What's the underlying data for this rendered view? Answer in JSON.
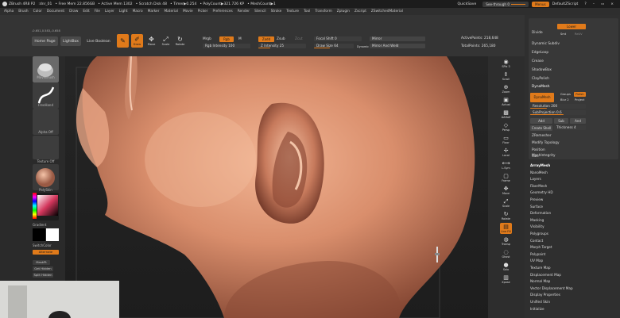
{
  "titlebar": {
    "app": "ZBrush 4R8 P2",
    "doc": ":dnr_01",
    "free_mem": "• Free Mem 22.856GB",
    "active_mem": "• Active Mem 1302",
    "scratch": "• Scratch Disk 48",
    "timer": "• Timer▶0.254",
    "polycount": "• PolyCount▶321.726 KP",
    "meshcount": "• MeshCount▶1",
    "quicksave": "QuickSave",
    "see_through": "See-through",
    "see_through_value": "0",
    "menus_label": "Menus",
    "default_script": "DefaultZScript"
  },
  "menubar": [
    "Alpha",
    "Brush",
    "Color",
    "Document",
    "Draw",
    "Edit",
    "File",
    "Layer",
    "Light",
    "Macro",
    "Marker",
    "Material",
    "Movie",
    "Picker",
    "Preferences",
    "Render",
    "Stencil",
    "Stroke",
    "Texture",
    "Tool",
    "Transform",
    "Zplugin",
    "Zscript",
    "ZSwitchedMaterial"
  ],
  "coords": "-0.651,0.583,-0.658",
  "toolbar": {
    "home_page": "Home Page",
    "lightbox": "LightBox",
    "live_boolean": "Live Boolean",
    "edit": "Edit",
    "draw": "Draw",
    "move": "Move",
    "scale": "Scale",
    "rotate": "Rotate",
    "mrgb": "Mrgb",
    "rgb": "Rgb",
    "m": "M",
    "rgb_intensity": "Rgb Intensity 100",
    "zadd": "Zadd",
    "zsub": "Zsub",
    "zcut": "Zcut",
    "z_intensity": "Z Intensity 25",
    "focal_shift": "Focal Shift 0",
    "draw_size": "Draw Size 64",
    "dynamic": "Dynamic",
    "mirror": "Mirror",
    "mirror_and_weld": "Mirror And Weld",
    "active_points": "ActivePoints: 218,648",
    "total_points": "TotalPoints: 265,180"
  },
  "leftpanel": {
    "brush_label": "MoveBrush",
    "stroke_label": "FreeHand",
    "alpha_label": "Alpha Off",
    "texture_label": "Texture Off",
    "material_label": "PolySkin",
    "gradient": "Gradient",
    "switch_color": "SwitchColor",
    "alternate": "Alternate",
    "mask_b": "MaskPt",
    "get_hidden": "Get Hidden",
    "split_hidden": "Split Hidden"
  },
  "rshelf": [
    "SPix 3",
    "Scroll",
    "Zoom",
    "Actual",
    "AAHalf",
    "Persp",
    "Floor",
    "Local",
    "L.Sym",
    "Frame",
    "Move",
    "Scale",
    "Rotate",
    "Line Fill",
    "Transp",
    "Ghost",
    "Solo",
    "Xpose"
  ],
  "geometry": {
    "divide": "Divide",
    "lower": "Lower",
    "smt": "Smt",
    "suv": "Suv",
    "reuv": "ReUV",
    "dynamic_subdiv": "Dynamic Subdiv",
    "edgeloop": "EdgeLoop",
    "crease": "Crease",
    "shadowbox": "ShadowBox",
    "claypolish": "ClayPolish",
    "dynamesh_header": "DynaMesh",
    "dynamesh_btn": "DynaMesh",
    "groups": "Groups",
    "polish": "Polish",
    "blur": "Blur 2",
    "project": "Project",
    "resolution": "Resolution 200",
    "subprojection": "SubProjection 0.6",
    "add": "Add",
    "sub": "Sub",
    "and": "And",
    "create_shell": "Create Shell",
    "thickness": "Thickness 4",
    "zremesher": "ZRemesher",
    "modify_topology": "Modify Topology",
    "position": "Position",
    "size": "Size",
    "meshintegrity": "MeshIntegrity"
  },
  "subpalettes": [
    "ArrayMesh",
    "NanoMesh",
    "Layers",
    "FiberMesh",
    "Geometry HD",
    "Preview",
    "Surface",
    "Deformation",
    "Masking",
    "Visibility",
    "Polygroups",
    "Contact",
    "Morph Target",
    "Polypaint",
    "UV Map",
    "Texture Map",
    "Displacement Map",
    "Normal Map",
    "Vector Displacement Map",
    "Display Properties",
    "Unified Skin",
    "Initialize"
  ],
  "colors": {
    "accent": "#e07a1a",
    "canvas": "#242424",
    "panel": "#343434"
  }
}
